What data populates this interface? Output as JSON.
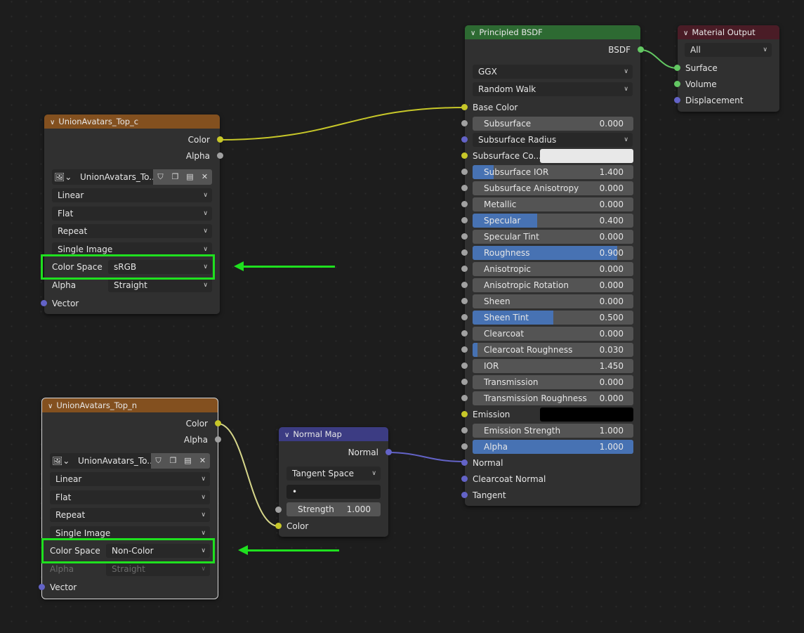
{
  "image_node_color": {
    "title": "UnionAvatars_Top_c",
    "outputs": [
      "Color",
      "Alpha"
    ],
    "image_name": "UnionAvatars_To...",
    "interpolation": "Linear",
    "projection": "Flat",
    "extension": "Repeat",
    "source": "Single Image",
    "color_space_label": "Color Space",
    "color_space": "sRGB",
    "alpha_label": "Alpha",
    "alpha_mode": "Straight",
    "input": "Vector"
  },
  "image_node_normal": {
    "title": "UnionAvatars_Top_n",
    "outputs": [
      "Color",
      "Alpha"
    ],
    "image_name": "UnionAvatars_To...",
    "interpolation": "Linear",
    "projection": "Flat",
    "extension": "Repeat",
    "source": "Single Image",
    "color_space_label": "Color Space",
    "color_space": "Non-Color",
    "alpha_label": "Alpha",
    "alpha_mode": "Straight",
    "input": "Vector"
  },
  "normal_map_node": {
    "title": "Normal Map",
    "output": "Normal",
    "space": "Tangent Space",
    "uv_map": "•",
    "strength_label": "Strength",
    "strength": "1.000",
    "input": "Color"
  },
  "bsdf_node": {
    "title": "Principled BSDF",
    "output": "BSDF",
    "distribution": "GGX",
    "subsurface_method": "Random Walk",
    "base_color_label": "Base Color",
    "subsurface": {
      "label": "Subsurface",
      "value": "0.000",
      "fill": 0
    },
    "subsurface_radius": "Subsurface Radius",
    "subsurface_color_label": "Subsurface Co...",
    "subsurface_color": "#e8e8e8",
    "sliders": [
      {
        "label": "Subsurface IOR",
        "value": "1.400",
        "fill": 0.13
      },
      {
        "label": "Subsurface Anisotropy",
        "value": "0.000",
        "fill": 0
      },
      {
        "label": "Metallic",
        "value": "0.000",
        "fill": 0
      },
      {
        "label": "Specular",
        "value": "0.400",
        "fill": 0.4
      },
      {
        "label": "Specular Tint",
        "value": "0.000",
        "fill": 0
      },
      {
        "label": "Roughness",
        "value": "0.900",
        "fill": 0.9
      },
      {
        "label": "Anisotropic",
        "value": "0.000",
        "fill": 0
      },
      {
        "label": "Anisotropic Rotation",
        "value": "0.000",
        "fill": 0
      },
      {
        "label": "Sheen",
        "value": "0.000",
        "fill": 0
      },
      {
        "label": "Sheen Tint",
        "value": "0.500",
        "fill": 0.5
      },
      {
        "label": "Clearcoat",
        "value": "0.000",
        "fill": 0
      },
      {
        "label": "Clearcoat Roughness",
        "value": "0.030",
        "fill": 0.03
      },
      {
        "label": "IOR",
        "value": "1.450",
        "fill": 0
      },
      {
        "label": "Transmission",
        "value": "0.000",
        "fill": 0
      },
      {
        "label": "Transmission Roughness",
        "value": "0.000",
        "fill": 0
      }
    ],
    "emission_label": "Emission",
    "emission_color": "#000000",
    "emission_strength": {
      "label": "Emission Strength",
      "value": "1.000",
      "fill": 0
    },
    "alpha": {
      "label": "Alpha",
      "value": "1.000",
      "fill": 1
    },
    "vector_inputs": [
      "Normal",
      "Clearcoat Normal",
      "Tangent"
    ]
  },
  "output_node": {
    "title": "Material Output",
    "target": "All",
    "inputs": [
      "Surface",
      "Volume",
      "Displacement"
    ]
  },
  "colors": {
    "image_header": "#83501f",
    "normal_map_header": "#3c3c83",
    "bsdf_header": "#2d6a32",
    "output_header": "#4a1c26",
    "highlight": "#1fe01f",
    "slider_fill": "#4772b3"
  }
}
